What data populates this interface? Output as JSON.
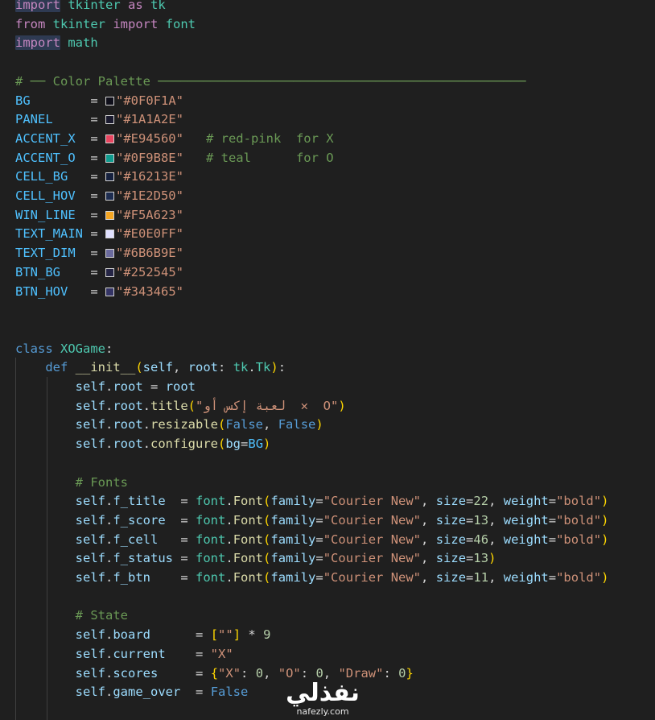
{
  "code_lines": [
    "import tkinter as tk",
    "from tkinter import font",
    "import math",
    "",
    "# ── Color Palette ─────────────────────────────────────────────────",
    "BG        = \"#0F0F1A\"",
    "PANEL     = \"#1A1A2E\"",
    "ACCENT_X  = \"#E94560\"   # red-pink  for X",
    "ACCENT_O  = \"#0F9B8E\"   # teal      for O",
    "CELL_BG   = \"#16213E\"",
    "CELL_HOV  = \"#1E2D50\"",
    "WIN_LINE  = \"#F5A623\"",
    "TEXT_MAIN = \"#E0E0FF\"",
    "TEXT_DIM  = \"#6B6B9E\"",
    "BTN_BG    = \"#252545\"",
    "BTN_HOV   = \"#343465\"",
    "",
    "",
    "class XOGame:",
    "    def __init__(self, root: tk.Tk):",
    "        self.root = root",
    "        self.root.title(\"لعبة إكس أو  ✕  O\")",
    "        self.root.resizable(False, False)",
    "        self.root.configure(bg=BG)",
    "",
    "        # Fonts",
    "        self.f_title  = font.Font(family=\"Courier New\", size=22, weight=\"bold\")",
    "        self.f_score  = font.Font(family=\"Courier New\", size=13, weight=\"bold\")",
    "        self.f_cell   = font.Font(family=\"Courier New\", size=46, weight=\"bold\")",
    "        self.f_status = font.Font(family=\"Courier New\", size=13)",
    "        self.f_btn    = font.Font(family=\"Courier New\", size=11, weight=\"bold\")",
    "",
    "        # State",
    "        self.board      = [\"\"] * 9",
    "        self.current    = \"X\"",
    "        self.scores     = {\"X\": 0, \"O\": 0, \"Draw\": 0}",
    "        self.game_over  = False"
  ],
  "palette": [
    {
      "name": "BG",
      "hex": "#0F0F1A"
    },
    {
      "name": "PANEL",
      "hex": "#1A1A2E"
    },
    {
      "name": "ACCENT_X",
      "hex": "#E94560",
      "comment": "# red-pink  for X"
    },
    {
      "name": "ACCENT_O",
      "hex": "#0F9B8E",
      "comment": "# teal      for O"
    },
    {
      "name": "CELL_BG",
      "hex": "#16213E"
    },
    {
      "name": "CELL_HOV",
      "hex": "#1E2D50"
    },
    {
      "name": "WIN_LINE",
      "hex": "#F5A623"
    },
    {
      "name": "TEXT_MAIN",
      "hex": "#E0E0FF"
    },
    {
      "name": "TEXT_DIM",
      "hex": "#6B6B9E"
    },
    {
      "name": "BTN_BG",
      "hex": "#252545"
    },
    {
      "name": "BTN_HOV",
      "hex": "#343465"
    }
  ],
  "watermark": {
    "logo_text": "نفذلي",
    "url": "nafezly.com"
  },
  "colors": {
    "editor_bg": "#1f1f1f",
    "keyword": "#569cd6",
    "control_keyword": "#c586c0",
    "string": "#ce9178",
    "comment": "#6a9955",
    "number": "#b5cea8",
    "class_name": "#4ec9b0",
    "function": "#dcdcaa",
    "variable": "#9cdcfe"
  }
}
